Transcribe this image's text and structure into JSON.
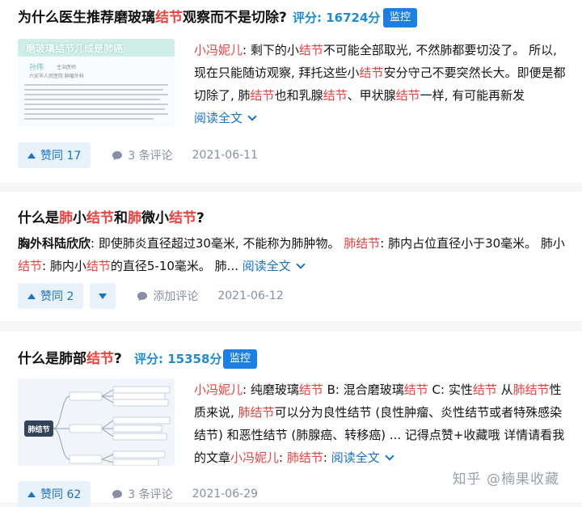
{
  "colors": {
    "highlight": "#e8413e",
    "link": "#1772c9",
    "score": "#1a8cd8",
    "monitor_bg": "#1e7fe3",
    "vote_bg": "#e9f1fb",
    "meta": "#8590a6"
  },
  "cards": [
    {
      "title_parts": [
        "为什么医生推荐磨玻璃",
        "结节",
        "观察而不是切除?"
      ],
      "score": "评分: 16724分",
      "monitor": "监控",
      "thumb": {
        "headline": "磨玻璃结节几成是肺癌",
        "name": "孙伟",
        "role": "主治医师",
        "org": "六安市人民医院  肿瘤外科"
      },
      "excerpt_parts": [
        "小冯妮儿",
        ": 剩下的小",
        "结节",
        "不可能全部取光, 不然肺都要切没了。 所以, 现在只能随访观察, 拜托这些小",
        "结节",
        "安分守己不要突然长大。即便是都切除了, 肺",
        "结节",
        "也和乳腺",
        "结节",
        "、甲状腺",
        "结节",
        "一样, 有可能再新发"
      ],
      "read_more": "阅读全文",
      "vote": "赞同 17",
      "comments": "3 条评论",
      "date": "2021-06-11"
    },
    {
      "title_parts": [
        "什么是",
        "肺",
        "小",
        "结节",
        "和",
        "肺",
        "微小",
        "结节",
        "?"
      ],
      "excerpt_parts": [
        "胸外科陆欣欣",
        ": 即使肺炎直径超过30毫米, 不能称为肺肿物。 ",
        "肺结节",
        ": 肺内占位直径小于30毫米。 肺小",
        "结节",
        ": 肺内小",
        "结节",
        "的直径5-10毫米。 肺..."
      ],
      "read_more": "阅读全文",
      "vote": "赞同 2",
      "comments": "添加评论",
      "date": "2021-06-12"
    },
    {
      "title_parts": [
        "什么是肺部",
        "结节",
        "?"
      ],
      "score": "评分: 15358分",
      "monitor": "监控",
      "thumb": {
        "center": "肺结节"
      },
      "excerpt_parts": [
        "小冯妮儿",
        ": 纯磨玻璃",
        "结节",
        " B: 混合磨玻璃",
        "结节",
        " C: 实性",
        "结节",
        " 从",
        "肺结节",
        "性质来说, ",
        "肺结节",
        "可以分为良性结节 (良性肿瘤、炎性结节或者特殊感染结节) 和恶性结节 (肺腺癌、转移癌) ... 记得点赞+收藏哦 详情请看我的文章",
        "小冯妮儿",
        ": ",
        "肺结节",
        ":"
      ],
      "read_more": "阅读全文",
      "vote": "赞同 62",
      "comments": "3 条评论",
      "date": "2021-06-29"
    }
  ],
  "watermark": "知乎 @楠果收藏"
}
